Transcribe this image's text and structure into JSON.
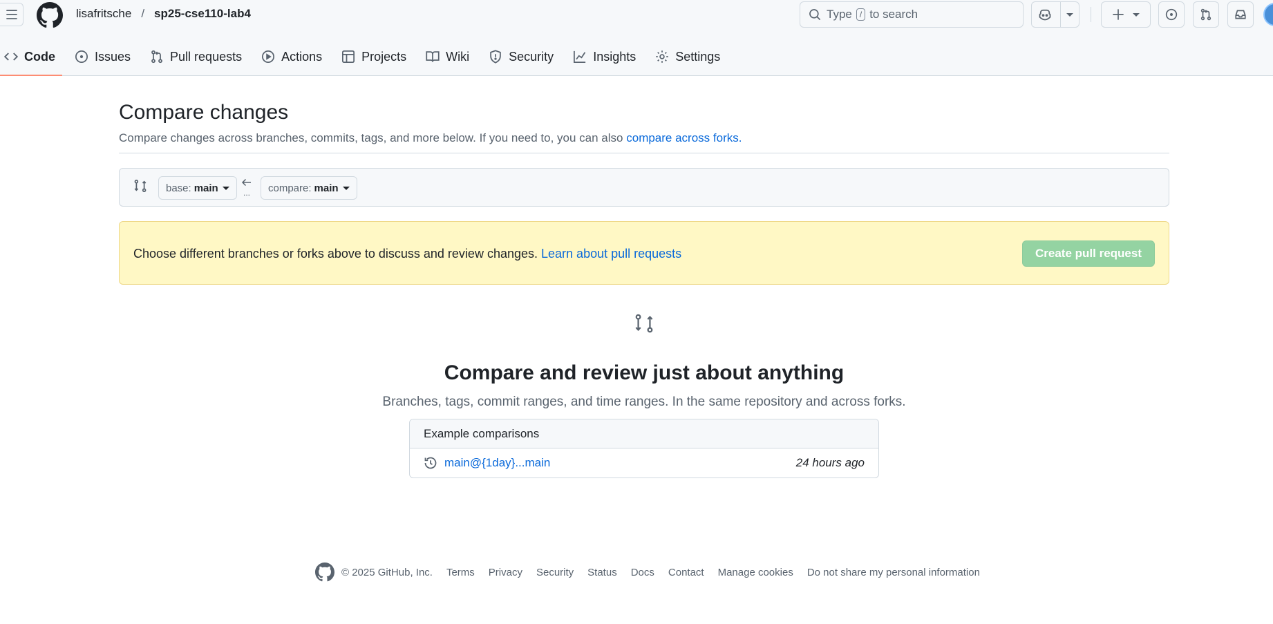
{
  "header": {
    "owner": "lisafritsche",
    "separator": "/",
    "repo": "sp25-cse110-lab4",
    "search": {
      "prefix": "Type",
      "key": "/",
      "suffix": "to search"
    }
  },
  "nav": {
    "items": [
      {
        "label": "Code",
        "icon": "code-icon"
      },
      {
        "label": "Issues",
        "icon": "issue-icon"
      },
      {
        "label": "Pull requests",
        "icon": "pull-request-icon"
      },
      {
        "label": "Actions",
        "icon": "play-icon"
      },
      {
        "label": "Projects",
        "icon": "table-icon"
      },
      {
        "label": "Wiki",
        "icon": "book-icon"
      },
      {
        "label": "Security",
        "icon": "shield-icon"
      },
      {
        "label": "Insights",
        "icon": "graph-icon"
      },
      {
        "label": "Settings",
        "icon": "gear-icon"
      }
    ]
  },
  "compare": {
    "title": "Compare changes",
    "subtitle_text": "Compare changes across branches, commits, tags, and more below. If you need to, you can also",
    "subtitle_link": "compare across forks.",
    "base_label": "base:",
    "base_value": "main",
    "compare_label": "compare:",
    "compare_value": "main",
    "dots": "..."
  },
  "flash": {
    "message": "Choose different branches or forks above to discuss and review changes.",
    "link": "Learn about pull requests",
    "button": "Create pull request"
  },
  "blank": {
    "heading": "Compare and review just about anything",
    "text": "Branches, tags, commit ranges, and time ranges. In the same repository and across forks."
  },
  "examples": {
    "header": "Example comparisons",
    "rows": [
      {
        "link": "main@{1day}...main",
        "time": "24 hours ago"
      }
    ]
  },
  "footer": {
    "copyright": "© 2025 GitHub, Inc.",
    "links": [
      "Terms",
      "Privacy",
      "Security",
      "Status",
      "Docs",
      "Contact",
      "Manage cookies",
      "Do not share my personal information"
    ]
  },
  "colors": {
    "accent_link": "#0969da",
    "nav_underline": "#fd8c73",
    "flash_bg": "#fff8c5",
    "create_button_bg": "#94d3a2"
  }
}
